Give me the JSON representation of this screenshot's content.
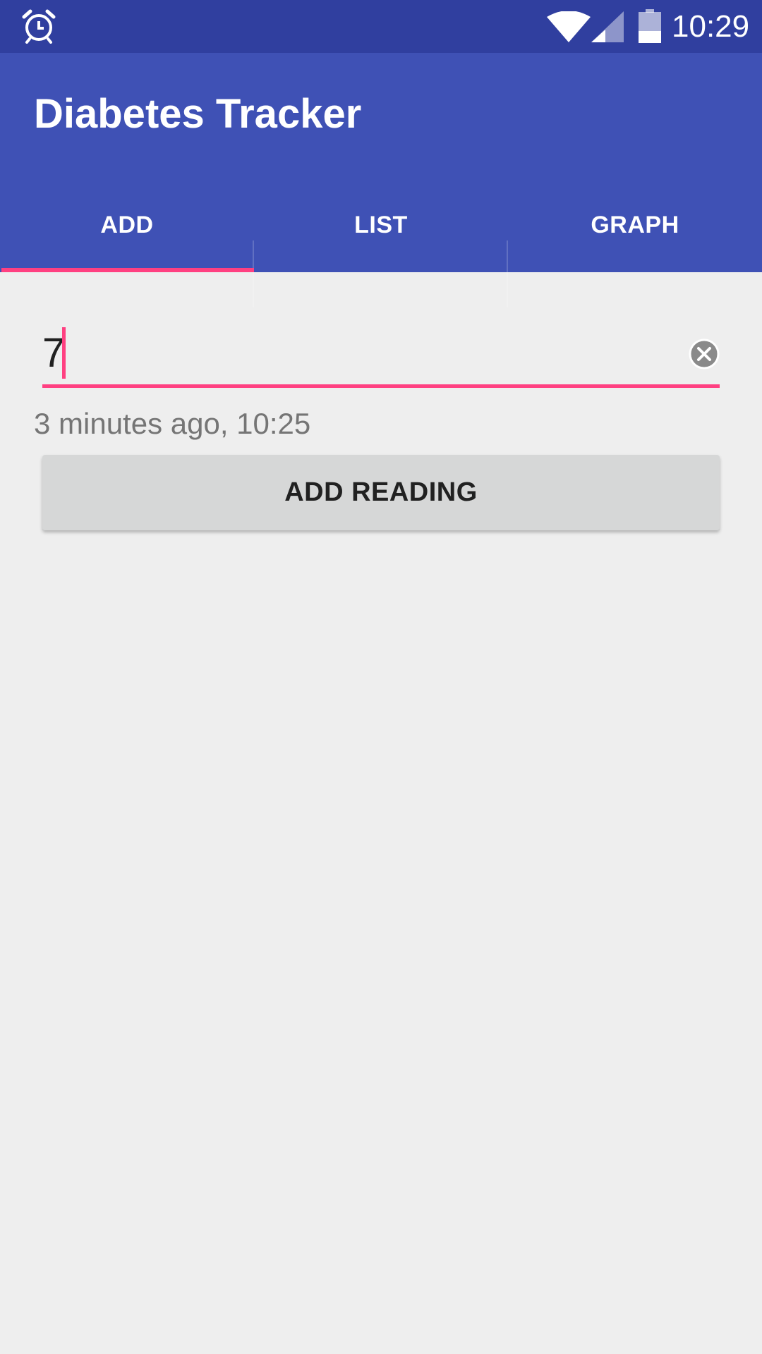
{
  "status_bar": {
    "time": "10:29",
    "icons": [
      "alarm-icon",
      "wifi-icon",
      "signal-icon",
      "battery-icon"
    ]
  },
  "app_bar": {
    "title": "Diabetes Tracker"
  },
  "tabs": [
    {
      "label": "ADD",
      "selected": true
    },
    {
      "label": "LIST",
      "selected": false
    },
    {
      "label": "GRAPH",
      "selected": false
    }
  ],
  "reading_input": {
    "value": "7",
    "clear_icon": "clear-icon"
  },
  "timestamp": "3 minutes ago, 10:25",
  "add_button": {
    "label": "ADD READING"
  },
  "colors": {
    "status_bar": "#303f9f",
    "primary": "#3f51b5",
    "accent": "#ff4081",
    "background": "#eeeeee",
    "button": "#d6d7d7"
  }
}
